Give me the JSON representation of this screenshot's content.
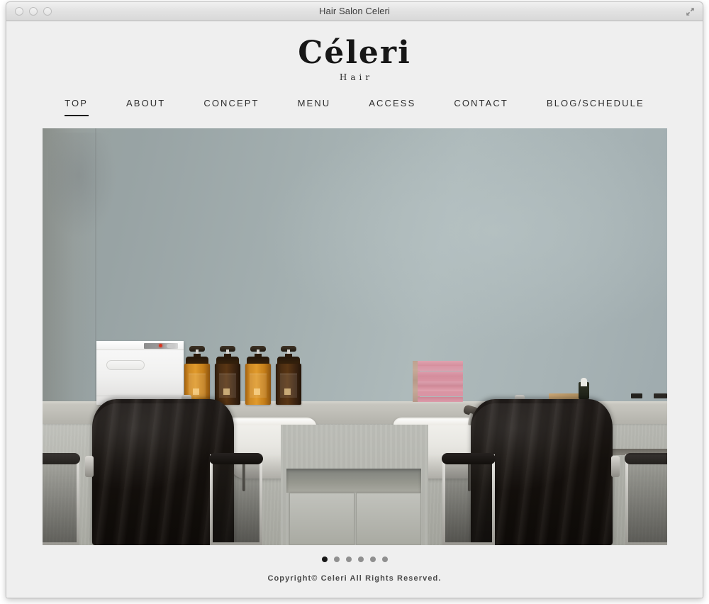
{
  "window": {
    "title": "Hair Salon Celeri",
    "controls": [
      "close",
      "minimize",
      "zoom"
    ],
    "expand_icon": "fullscreen-arrows-icon"
  },
  "site": {
    "logo_main": "Céleri",
    "logo_sub": "Hair",
    "background_color": "#efefef",
    "text_color": "#2e2e2e"
  },
  "nav": {
    "items": [
      {
        "label": "TOP",
        "active": true
      },
      {
        "label": "ABOUT",
        "active": false
      },
      {
        "label": "CONCEPT",
        "active": false
      },
      {
        "label": "MENU",
        "active": false
      },
      {
        "label": "ACCESS",
        "active": false
      },
      {
        "label": "CONTACT",
        "active": false
      },
      {
        "label": "BLOG/SCHEDULE",
        "active": false
      }
    ],
    "active_underline_color": "#1d1d1d"
  },
  "hero": {
    "alt": "Hair salon interior with two black shampoo chairs, white basins, amber pump bottles and pink towels on a concrete counter against a pale blue-gray wall",
    "slides_total": 6,
    "active_slide": 1,
    "dots": [
      {
        "index": 1,
        "active": true
      },
      {
        "index": 2,
        "active": false
      },
      {
        "index": 3,
        "active": false
      },
      {
        "index": 4,
        "active": false
      },
      {
        "index": 5,
        "active": false
      },
      {
        "index": 6,
        "active": false
      }
    ],
    "scene": {
      "wall_color": "#a7b3b4",
      "counter_color": "#b5b6af",
      "bottles": [
        {
          "index": 1,
          "tone": "amber"
        },
        {
          "index": 2,
          "tone": "dark"
        },
        {
          "index": 3,
          "tone": "amber"
        },
        {
          "index": 4,
          "tone": "dark"
        }
      ],
      "towels": {
        "color": "#d9909f",
        "count": 8
      },
      "warmer": {
        "label": "towel-warmer-cabinet",
        "led_color": "#d9341f"
      }
    }
  },
  "footer": {
    "copyright": "Copyright© Celeri All Rights Reserved."
  }
}
